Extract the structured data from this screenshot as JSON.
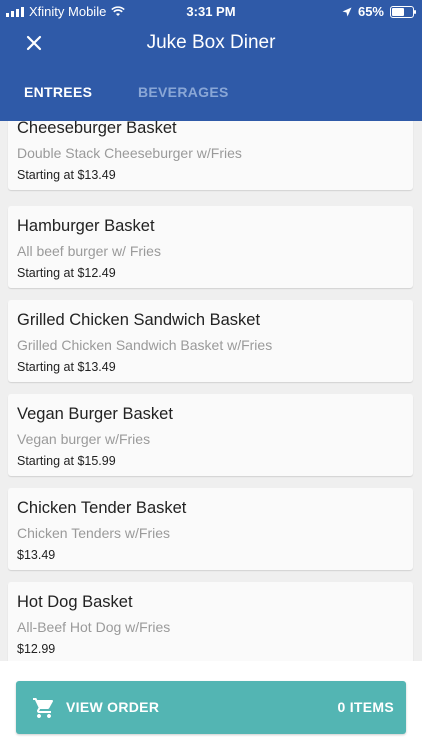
{
  "status": {
    "carrier": "Xfinity Mobile",
    "time": "3:31 PM",
    "battery": "65%",
    "battery_level": 0.65
  },
  "header": {
    "title": "Juke Box Diner",
    "tabs": [
      {
        "label": "ENTREES",
        "active": true
      },
      {
        "label": "BEVERAGES",
        "active": false
      }
    ]
  },
  "items": [
    {
      "name": "Cheeseburger Basket",
      "desc": "Double Stack Cheeseburger w/Fries",
      "price": "Starting at $13.49"
    },
    {
      "name": "Hamburger Basket",
      "desc": "All beef burger w/ Fries",
      "price": "Starting at $12.49"
    },
    {
      "name": "Grilled Chicken Sandwich Basket",
      "desc": "Grilled Chicken Sandwich Basket w/Fries",
      "price": "Starting at $13.49"
    },
    {
      "name": "Vegan Burger Basket",
      "desc": "Vegan burger w/Fries",
      "price": "Starting at $15.99"
    },
    {
      "name": "Chicken Tender Basket",
      "desc": "Chicken Tenders w/Fries",
      "price": "$13.49"
    },
    {
      "name": "Hot Dog Basket",
      "desc": "All-Beef Hot Dog w/Fries",
      "price": "$12.99"
    }
  ],
  "footer": {
    "order_label": "VIEW ORDER",
    "items_label": "0 ITEMS"
  },
  "colors": {
    "header": "#2f5aa8",
    "button": "#53b5b3"
  },
  "icons": {
    "close": "close-icon",
    "cart": "cart-icon"
  }
}
